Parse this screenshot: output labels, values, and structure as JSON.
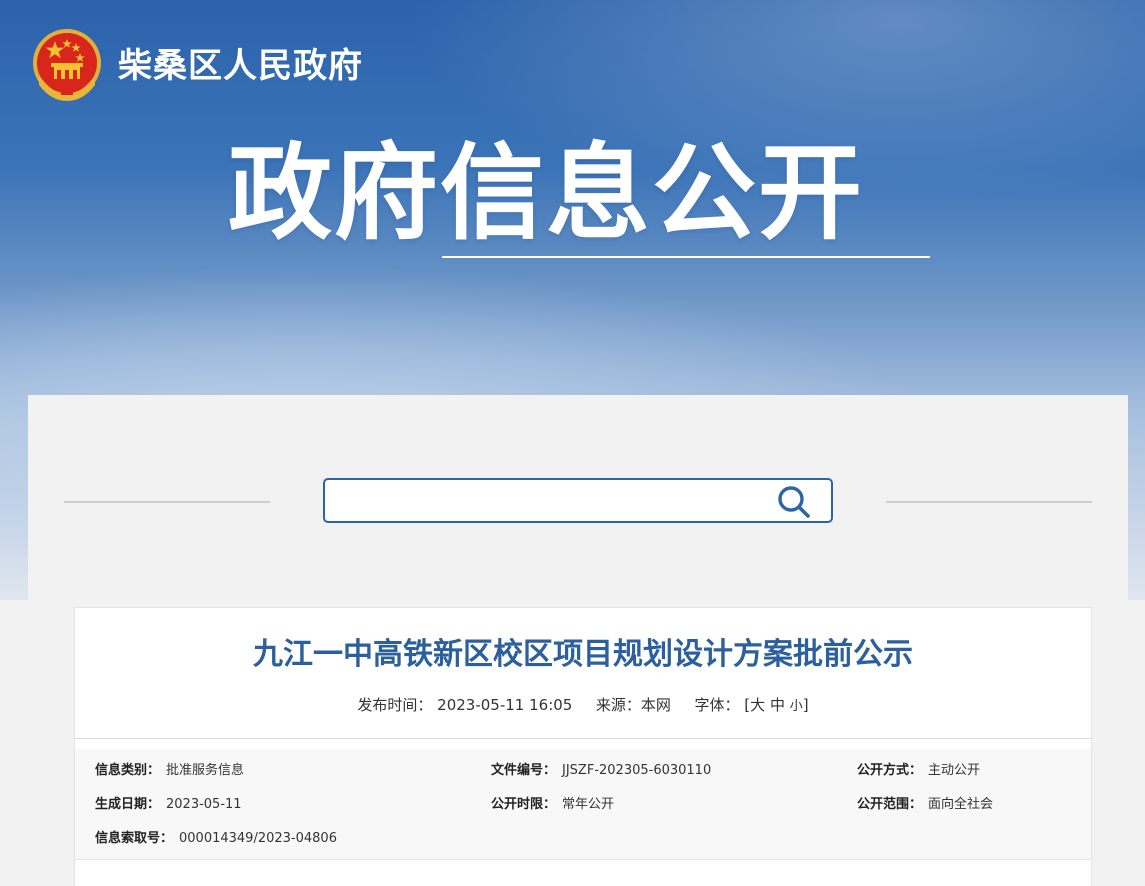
{
  "header": {
    "site_name": "柴桑区人民政府",
    "hero_title": "政府信息公开"
  },
  "search": {
    "placeholder": "",
    "button_icon": "search-icon"
  },
  "article": {
    "title": "九江一中高铁新区校区项目规划设计方案批前公示",
    "publish_label": "发布时间：",
    "publish_time": "2023-05-11 16:05",
    "source_label": "来源：",
    "source": "本网",
    "font_label": "字体：",
    "bracket_open": "[",
    "font_large": "大",
    "font_medium": "中",
    "font_small": "小",
    "bracket_close": "]"
  },
  "info": {
    "category_label": "信息类别：",
    "category": "批准服务信息",
    "doc_no_label": "文件编号：",
    "doc_no": "JJSZF-202305-6030110",
    "open_mode_label": "公开方式：",
    "open_mode": "主动公开",
    "gen_date_label": "生成日期：",
    "gen_date": "2023-05-11",
    "open_period_label": "公开时限：",
    "open_period": "常年公开",
    "open_scope_label": "公开范围：",
    "open_scope": "面向全社会",
    "index_no_label": "信息索取号：",
    "index_no": "000014349/2023-04806"
  },
  "colors": {
    "brand_blue": "#2c5f9e",
    "search_border": "#2c65a6",
    "emblem_red": "#d8261d",
    "emblem_gold": "#f2c230"
  }
}
